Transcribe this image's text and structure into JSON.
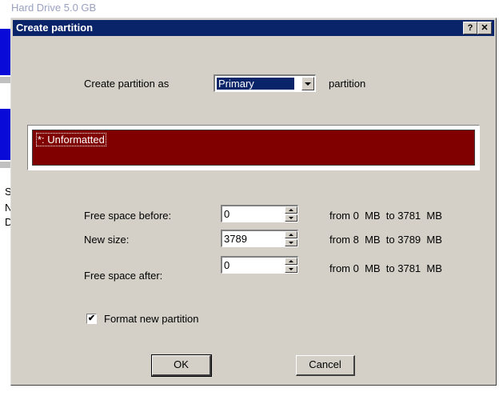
{
  "background": {
    "title_fragment": "Hard Drive 5.0 GB",
    "frag_s": "S",
    "frag_n": "N",
    "frag_d": "D"
  },
  "dialog": {
    "title": "Create partition",
    "help_button": "?",
    "close_button": "✕",
    "create_as_label": "Create partition as",
    "partition_type": {
      "selected": "Primary"
    },
    "partition_suffix": "partition",
    "partition_bar": {
      "label": "*: Unformatted",
      "color": "#800000"
    },
    "fields": [
      {
        "label": "Free space before:",
        "value": "0",
        "range": "from 0  MB  to 3781  MB"
      },
      {
        "label": "New size:",
        "value": "3789",
        "range": "from 8  MB  to 3789  MB"
      },
      {
        "label": "Free space after:",
        "value": "0",
        "range": "from 0  MB  to 3781  MB"
      }
    ],
    "format_checkbox": {
      "label": "Format new partition",
      "checked": true,
      "mark": "✔"
    },
    "ok_label": "OK",
    "cancel_label": "Cancel"
  },
  "colors": {
    "titlebar": "#0a246a",
    "dialog_bg": "#d4d0c8",
    "partition": "#800000"
  }
}
